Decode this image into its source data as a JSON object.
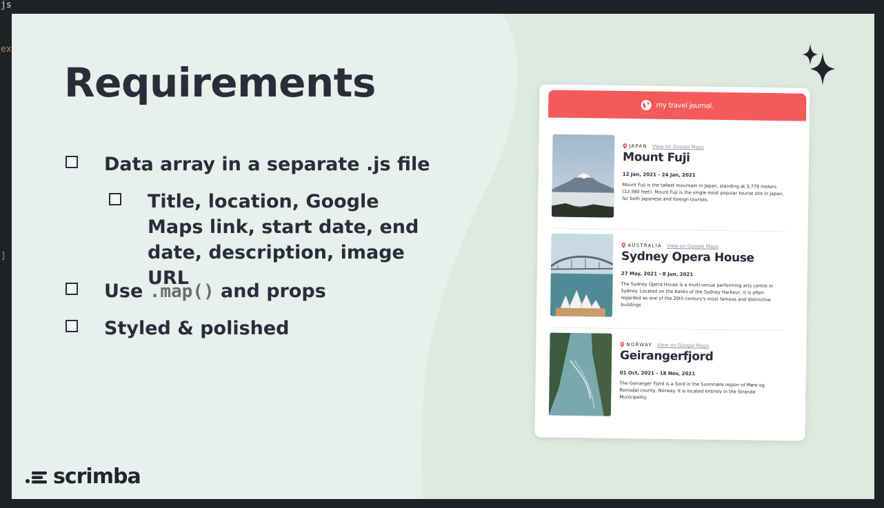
{
  "editor_peek": {
    "line1": "js",
    "line2": "ex",
    "line3": "]"
  },
  "slide": {
    "title": "Requirements",
    "requirements": [
      {
        "text": "Data array in a separate .js file"
      },
      {
        "text": "Title, location, Google Maps link, start date, end date, description, image URL"
      },
      {
        "text_before": "Use",
        "code": ".map()",
        "text_after": "and props"
      },
      {
        "text": "Styled & polished"
      }
    ],
    "brand": "scrimba"
  },
  "travel_journal": {
    "header_title": "my travel journal.",
    "maps_link_label": "View on Google Maps",
    "entries": [
      {
        "location": "JAPAN",
        "title": "Mount Fuji",
        "dates": "12 Jan, 2021 - 24 Jan, 2021",
        "description": "Mount Fuji is the tallest mountain in Japan, standing at 3,776 meters (12,380 feet). Mount Fuji is the single most popular tourist site in Japan, for both Japanese and foreign tourists."
      },
      {
        "location": "AUSTRALIA",
        "title": "Sydney Opera House",
        "dates": "27 May, 2021 - 8 Jun, 2021",
        "description": "The Sydney Opera House is a multi-venue performing arts centre in Sydney. Located on the banks of the Sydney Harbour, it is often regarded as one of the 20th century's most famous and distinctive buildings"
      },
      {
        "location": "NORWAY",
        "title": "Geirangerfjord",
        "dates": "01 Oct, 2021 - 18 Nov, 2021",
        "description": "The Geiranger Fjord is a fjord in the Sunnmøre region of Møre og Romsdal county, Norway. It is located entirely in the Stranda Municipality."
      }
    ]
  },
  "colors": {
    "slide_bg": "#dde9e1",
    "slide_bg_light": "#e7f0eb",
    "text_dark": "#2c2b3a",
    "header_red": "#f55a5a",
    "pin_red": "#f55a5a"
  }
}
